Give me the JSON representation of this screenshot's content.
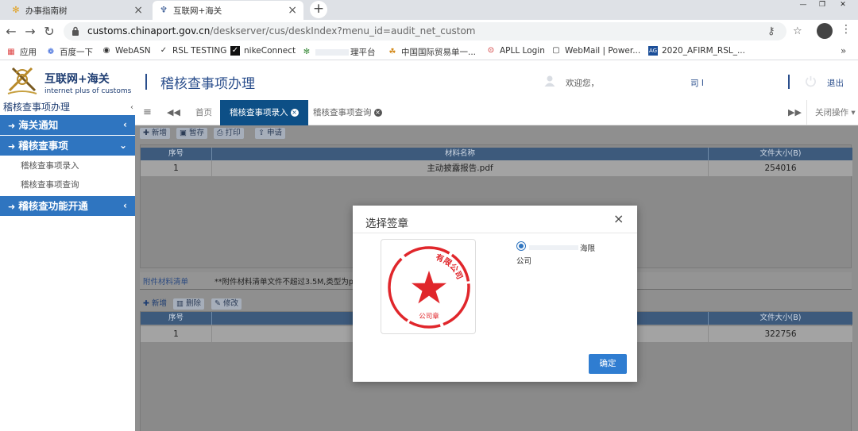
{
  "browser": {
    "tabs": [
      {
        "title": "办事指南树",
        "active": false
      },
      {
        "title": "互联网+海关",
        "active": true
      }
    ],
    "new_tab": "+",
    "url_host": "customs.chinaport.gov.cn",
    "url_path": "/deskserver/cus/deskIndex?menu_id=audit_net_custom",
    "bookmarks": [
      {
        "label": "应用"
      },
      {
        "label": "百度一下"
      },
      {
        "label": "WebASN"
      },
      {
        "label": "RSL TESTING"
      },
      {
        "label": "nikeConnect"
      },
      {
        "label": "理平台"
      },
      {
        "label": "中国国际贸易单一..."
      },
      {
        "label": "APLL Login"
      },
      {
        "label": "WebMail | Power..."
      },
      {
        "label": "2020_AFIRM_RSL_..."
      }
    ],
    "bookmarks_more": "»"
  },
  "header": {
    "logo_cn": "互联网+海关",
    "logo_en": "internet plus of customs",
    "title": "稽核查事项办理",
    "welcome": "欢迎您，",
    "company_short": "司 Ⅰ",
    "logout": "退出"
  },
  "sidebar": {
    "title": "稽核查事项办理",
    "collapse": "‹",
    "sections": [
      {
        "label": "海关通知",
        "chevron": "‹"
      },
      {
        "label": "稽核查事项",
        "chevron": "⌄"
      },
      {
        "label": "稽核查功能开通",
        "chevron": "‹"
      }
    ],
    "sub_items": [
      "稽核查事项录入",
      "稽核查事项查询"
    ]
  },
  "content_tabs": {
    "home": "首页",
    "active": "稽核查事项录入",
    "query": "稽核查事项查询",
    "close_ops": "关闭操作"
  },
  "toolbar": {
    "add": "新增",
    "save": "暂存",
    "print": "打印",
    "submit": "申请"
  },
  "table1": {
    "columns": [
      "序号",
      "材料名称",
      "文件大小(B)"
    ],
    "rows": [
      {
        "index": "1",
        "name": "主动披露报告.pdf",
        "size": "254016"
      }
    ]
  },
  "attachments": {
    "title": "附件材料清单",
    "note": "**附件材料清单文件不超过3.5M,类型为p",
    "add": "新增",
    "delete": "删除",
    "edit": "修改"
  },
  "table2": {
    "columns": [
      "序号",
      "文件大小(B)"
    ],
    "rows": [
      {
        "index": "1",
        "size": "322756"
      }
    ]
  },
  "modal": {
    "title": "选择签章",
    "close": "×",
    "seal_text": "公司章",
    "seal_arc": "有限公司",
    "option_text_1": "海限",
    "option_text_2": "公司",
    "confirm": "确定"
  },
  "colors": {
    "sidebar_blue": "#2f75c0",
    "active_tab": "#0d4f86",
    "seal_red": "#e0262b",
    "confirm_blue": "#2f7dd1"
  }
}
